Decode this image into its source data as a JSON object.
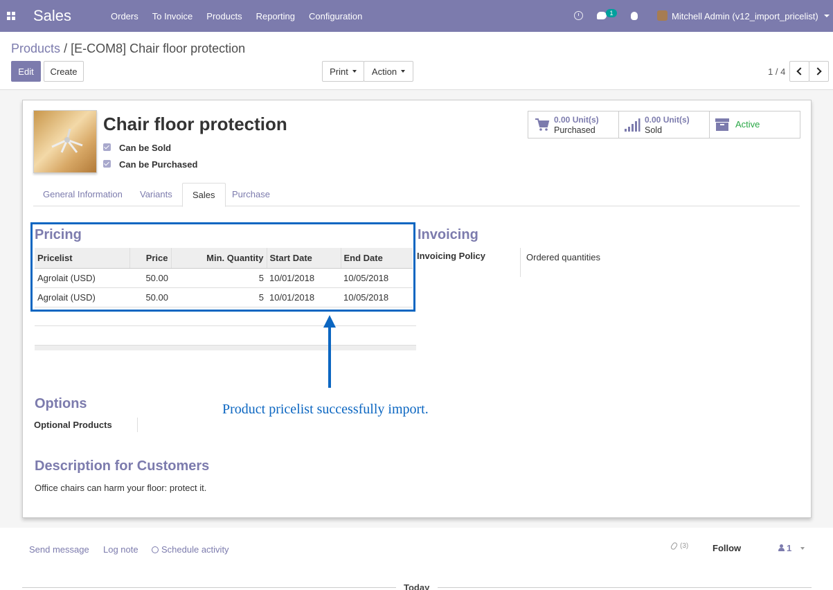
{
  "navbar": {
    "app_name": "Sales",
    "menu": [
      "Orders",
      "To Invoice",
      "Products",
      "Reporting",
      "Configuration"
    ],
    "chat_badge": "1",
    "user": "Mitchell Admin (v12_import_pricelist)",
    "color": "#7c7bad"
  },
  "breadcrumb": {
    "parent": "Products",
    "separator": "/",
    "current": "[E-COM8] Chair floor protection"
  },
  "controls": {
    "edit": "Edit",
    "create": "Create",
    "print": "Print",
    "action": "Action",
    "pager": "1 / 4"
  },
  "product": {
    "name": "Chair floor protection",
    "can_be_sold": "Can be Sold",
    "can_be_purchased": "Can be Purchased"
  },
  "stats": {
    "purchased_value": "0.00 Unit(s)",
    "purchased_label": "Purchased",
    "sold_value": "0.00 Unit(s)",
    "sold_label": "Sold",
    "active_label": "Active"
  },
  "tabs": [
    "General Information",
    "Variants",
    "Sales",
    "Purchase"
  ],
  "pricing": {
    "title": "Pricing",
    "columns": [
      "Pricelist",
      "Price",
      "Min. Quantity",
      "Start Date",
      "End Date"
    ],
    "rows": [
      [
        "Agrolait (USD)",
        "50.00",
        "5",
        "10/01/2018",
        "10/05/2018"
      ],
      [
        "Agrolait (USD)",
        "50.00",
        "5",
        "10/01/2018",
        "10/05/2018"
      ]
    ]
  },
  "annotation": "Product pricelist successfully import.",
  "invoicing": {
    "title": "Invoicing",
    "policy_label": "Invoicing Policy",
    "policy_value": "Ordered quantities"
  },
  "options": {
    "title": "Options",
    "optional_products_label": "Optional Products"
  },
  "description": {
    "title": "Description for Customers",
    "text": "Office chairs can harm your floor: protect it."
  },
  "chatter": {
    "send_message": "Send message",
    "log_note": "Log note",
    "schedule_activity": "Schedule activity",
    "attachments": "(3)",
    "follow": "Follow",
    "followers": "1",
    "today": "Today"
  }
}
